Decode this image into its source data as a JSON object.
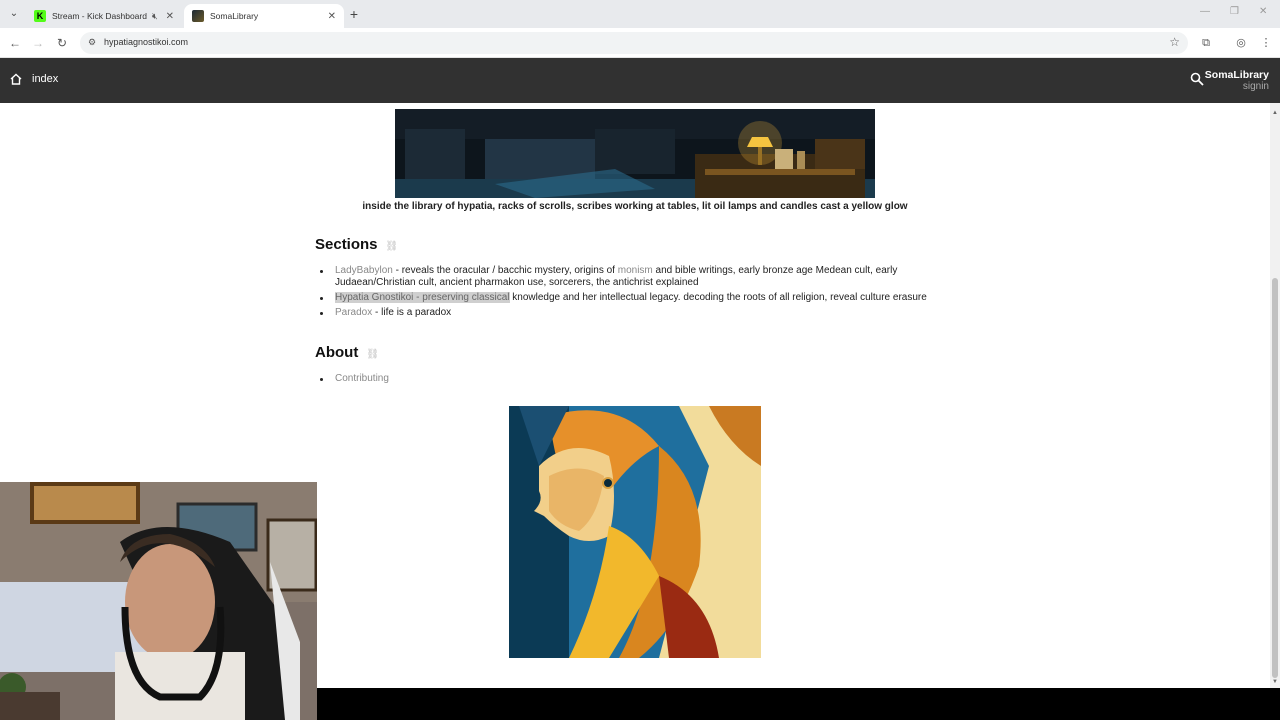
{
  "browser": {
    "tabs": [
      {
        "title": "Stream - Kick Dashboard"
      },
      {
        "title": "SomaLibrary"
      }
    ],
    "url": "hypatiagnostikoi.com"
  },
  "site": {
    "nav_home_label": "index",
    "brand_name": "SomaLibrary",
    "signin_label": "signin"
  },
  "page": {
    "banner_caption": "inside the library of hypatia, racks of scrolls, scribes working at tables, lit oil lamps and candles cast a yellow glow",
    "sections_heading": "Sections",
    "sections": [
      {
        "link": "LadyBabylon",
        "text_before": " - reveals the oracular / bacchic mystery, origins of ",
        "inline_link": "monism",
        "text_after": " and bible writings, early bronze age Medean cult, early Judaean/Christian cult, ancient pharmakon use, sorcerers, the antichrist explained"
      },
      {
        "link": "Hypatia Gnostikoi - preserving classical",
        "text": " knowledge and her intellectual legacy. decoding the roots of all religion, reveal culture erasure"
      },
      {
        "link": "Paradox",
        "text": " - life is a paradox"
      }
    ],
    "about_heading": "About",
    "about_items": [
      {
        "link": "Contributing"
      }
    ]
  },
  "icons": {
    "home": "home-icon",
    "search": "search-icon",
    "anchor": "link-icon",
    "star": "bookmark-star-icon"
  }
}
